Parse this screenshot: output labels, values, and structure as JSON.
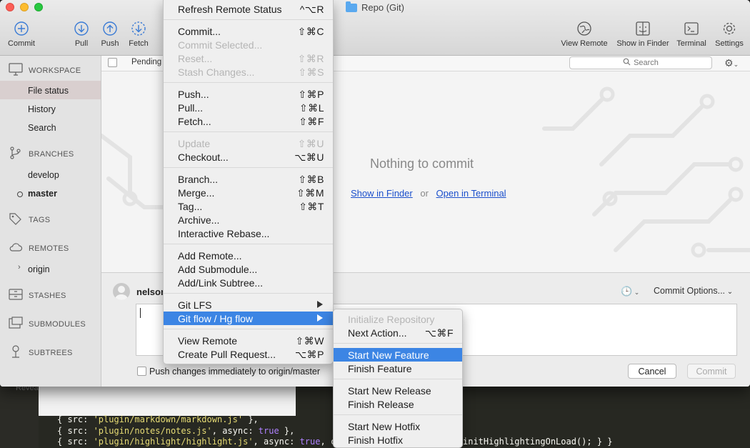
{
  "window": {
    "title": "Repo (Git)"
  },
  "toolbar": {
    "commit": "Commit",
    "pull": "Pull",
    "push": "Push",
    "fetch": "Fetch",
    "view_remote": "View Remote",
    "show_in_finder": "Show in Finder",
    "terminal": "Terminal",
    "settings": "Settings"
  },
  "sidebar": {
    "workspace": "WORKSPACE",
    "file_status": "File status",
    "history": "History",
    "search": "Search",
    "branches": "BRANCHES",
    "branch_develop": "develop",
    "branch_master": "master",
    "tags": "TAGS",
    "remotes": "REMOTES",
    "remote_origin": "origin",
    "stashes": "STASHES",
    "submodules": "SUBMODULES",
    "subtrees": "SUBTREES"
  },
  "main": {
    "pending": "Pending",
    "search_placeholder": "Search",
    "nothing_to_commit": "Nothing to commit",
    "show_in_finder": "Show in Finder",
    "or": "or",
    "open_in_terminal": "Open in Terminal"
  },
  "commit_area": {
    "author": "nelson",
    "commit_options": "Commit Options...",
    "push_label": "Push changes immediately to origin/master",
    "cancel": "Cancel",
    "commit": "Commit"
  },
  "menu": {
    "items": [
      {
        "label": "Refresh Remote Status",
        "shortcut": "^⌥R",
        "disabled": false
      },
      {
        "label": "Commit...",
        "shortcut": "⇧⌘C",
        "disabled": false
      },
      {
        "label": "Commit Selected...",
        "shortcut": "",
        "disabled": true
      },
      {
        "label": "Reset...",
        "shortcut": "⇧⌘R",
        "disabled": true
      },
      {
        "label": "Stash Changes...",
        "shortcut": "⇧⌘S",
        "disabled": true
      },
      {
        "label": "Push...",
        "shortcut": "⇧⌘P",
        "disabled": false
      },
      {
        "label": "Pull...",
        "shortcut": "⇧⌘L",
        "disabled": false
      },
      {
        "label": "Fetch...",
        "shortcut": "⇧⌘F",
        "disabled": false
      },
      {
        "label": "Update",
        "shortcut": "⇧⌘U",
        "disabled": true
      },
      {
        "label": "Checkout...",
        "shortcut": "⌥⌘U",
        "disabled": false
      },
      {
        "label": "Branch...",
        "shortcut": "⇧⌘B",
        "disabled": false
      },
      {
        "label": "Merge...",
        "shortcut": "⇧⌘M",
        "disabled": false
      },
      {
        "label": "Tag...",
        "shortcut": "⇧⌘T",
        "disabled": false
      },
      {
        "label": "Archive...",
        "shortcut": "",
        "disabled": false
      },
      {
        "label": "Interactive Rebase...",
        "shortcut": "",
        "disabled": false
      },
      {
        "label": "Add Remote...",
        "shortcut": "",
        "disabled": false
      },
      {
        "label": "Add Submodule...",
        "shortcut": "",
        "disabled": false
      },
      {
        "label": "Add/Link Subtree...",
        "shortcut": "",
        "disabled": false
      },
      {
        "label": "Git LFS",
        "shortcut": "",
        "disabled": false
      },
      {
        "label": "Git flow / Hg flow",
        "shortcut": "",
        "disabled": false,
        "highlighted": true
      },
      {
        "label": "View Remote",
        "shortcut": "⇧⌘W",
        "disabled": false
      },
      {
        "label": "Create Pull Request...",
        "shortcut": "⌥⌘P",
        "disabled": false
      }
    ]
  },
  "submenu": {
    "items": [
      {
        "label": "Initialize Repository",
        "shortcut": "",
        "disabled": true
      },
      {
        "label": "Next Action...",
        "shortcut": "⌥⌘F",
        "disabled": false
      },
      {
        "label": "Start New Feature",
        "shortcut": "",
        "disabled": false,
        "highlighted": true
      },
      {
        "label": "Finish Feature",
        "shortcut": "",
        "disabled": false
      },
      {
        "label": "Start New Release",
        "shortcut": "",
        "disabled": false
      },
      {
        "label": "Finish Release",
        "shortcut": "",
        "disabled": false
      },
      {
        "label": "Start New Hotfix",
        "shortcut": "",
        "disabled": false
      },
      {
        "label": "Finish Hotfix",
        "shortcut": "",
        "disabled": false
      }
    ]
  },
  "editor": {
    "reveal_label": "Revea",
    "lines": [
      {
        "pre": "{ src: ",
        "str": "'plugin/markdown/markdown.js'",
        "post": " },",
        "kw": "",
        "tail": ""
      },
      {
        "pre": "{ src: ",
        "str": "'plugin/notes/notes.js'",
        "post": ", async: ",
        "kw": "true",
        "tail": " },"
      },
      {
        "pre": "{ src: ",
        "str": "'plugin/highlight/highlight.js'",
        "post": ", async: ",
        "kw": "true",
        "tail": ", ca"
      }
    ],
    "line3_end": "initHighlightingOnLoad(); } }"
  },
  "colors": {
    "accent": "#3c85e4",
    "link": "#1a4fcc",
    "close": "#fc5f57",
    "minimize": "#fdbc2e",
    "maximize": "#28c840"
  },
  "icons": {
    "commit": "plus-circle-icon",
    "pull": "arrow-down-circle-icon",
    "push": "arrow-up-circle-icon",
    "fetch": "dashed-arrow-circle-icon",
    "view_remote": "globe-icon",
    "show_in_finder": "finder-icon",
    "terminal": "terminal-icon",
    "settings": "gear-icon",
    "submenu_arrow": "chevron-right-icon"
  }
}
